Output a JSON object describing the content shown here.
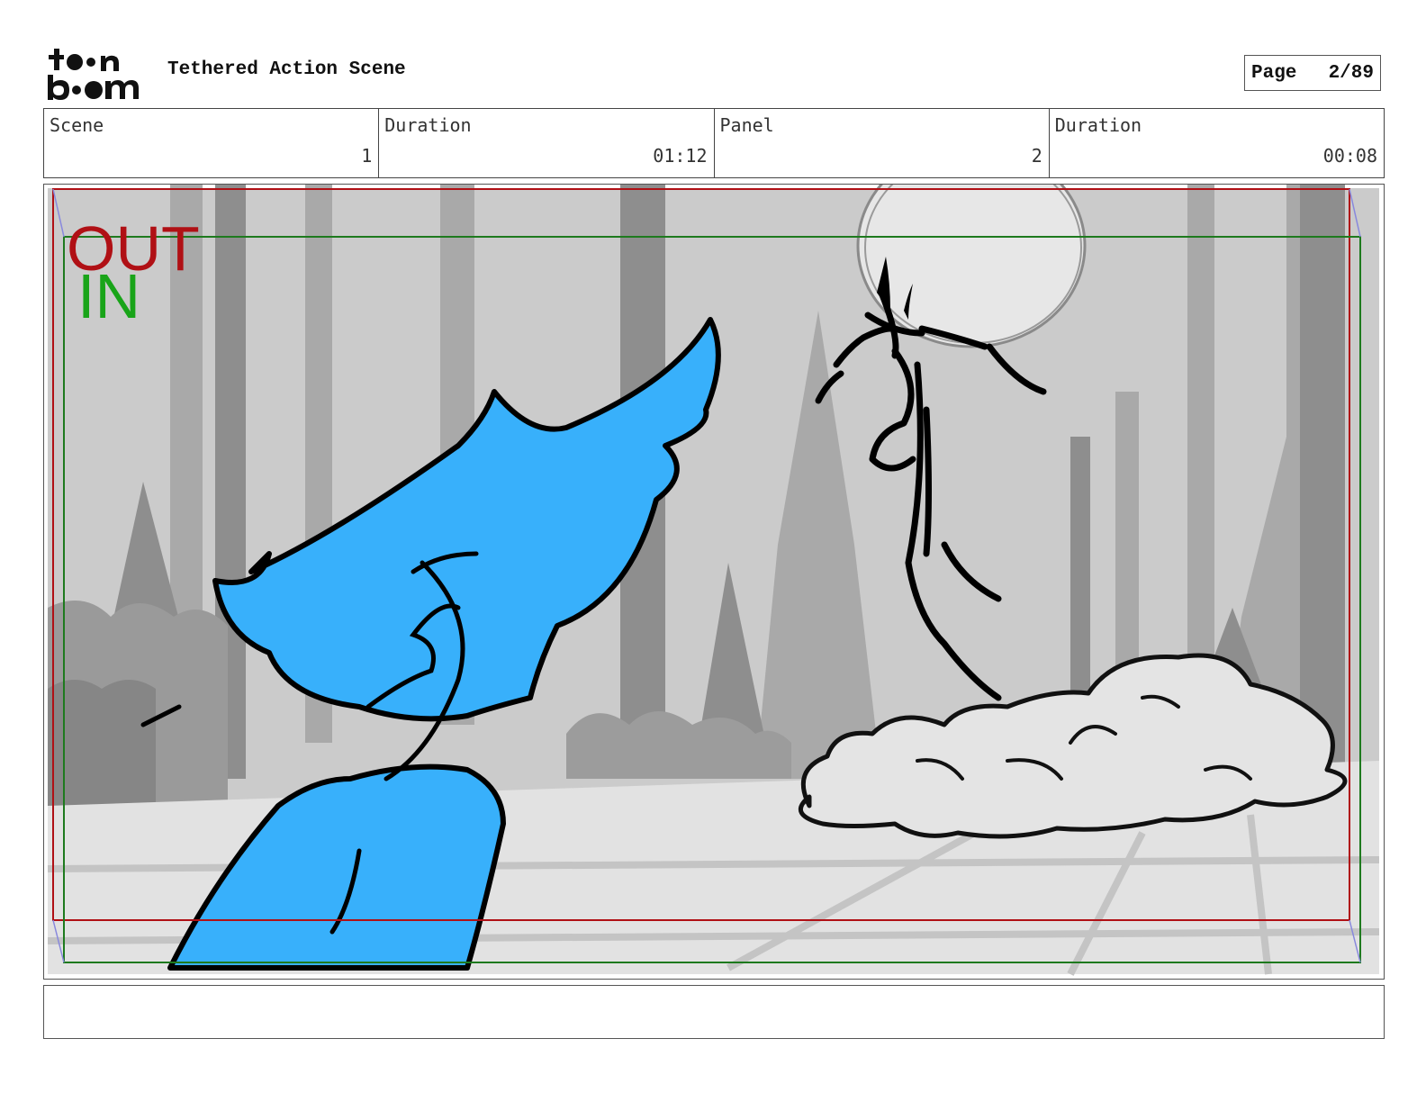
{
  "header": {
    "logo": {
      "line1": "toon",
      "line2": "boom"
    },
    "title": "Tethered Action Scene",
    "page_label": "Page",
    "page_number": "2/89"
  },
  "info": [
    {
      "label": "Scene",
      "value": "1"
    },
    {
      "label": "Duration",
      "value": "01:12"
    },
    {
      "label": "Panel",
      "value": "2"
    },
    {
      "label": "Duration",
      "value": "00:08"
    }
  ],
  "panel": {
    "frame_out_label": "OUT",
    "frame_in_label": "IN",
    "colors": {
      "out_frame": "#b01015",
      "in_frame": "#1e7a1e",
      "in_label": "#19a419",
      "character": "#38b0fb"
    }
  },
  "notes": {
    "text": ""
  }
}
